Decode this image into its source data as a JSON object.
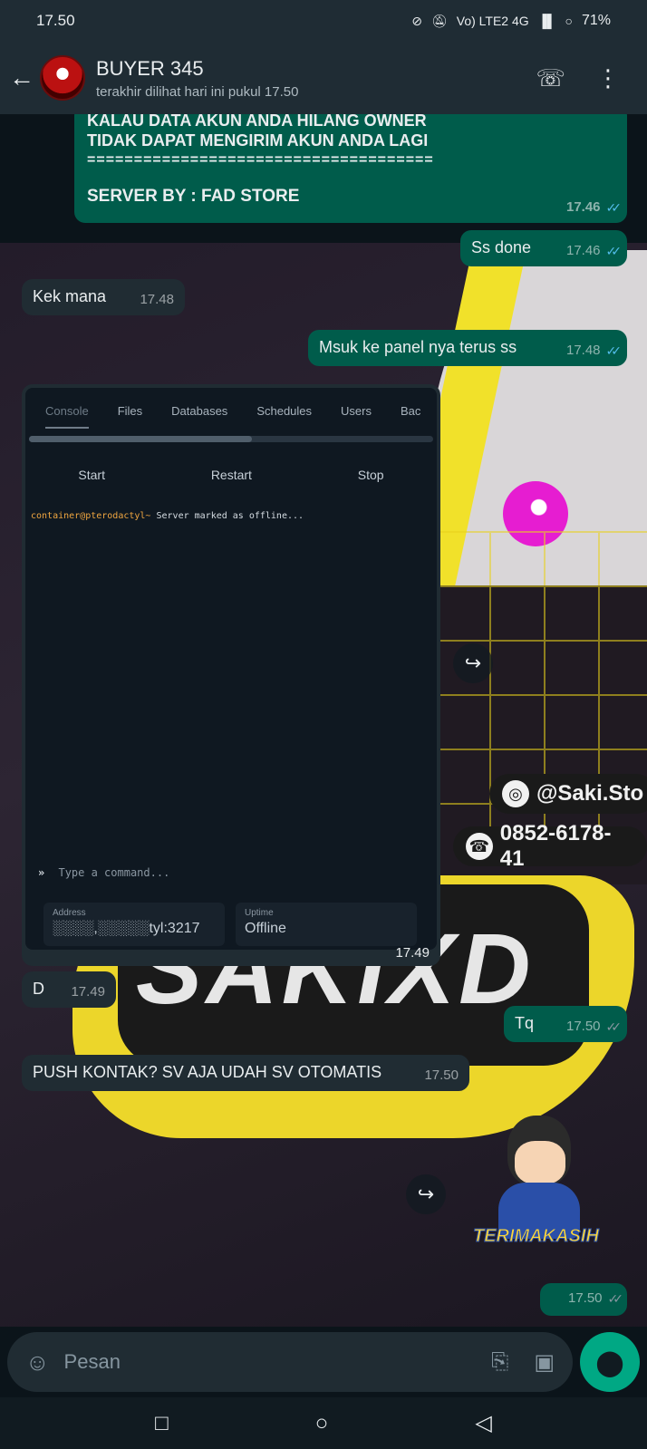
{
  "status_bar": {
    "time": "17.50",
    "network": "Vo) LTE2 4G",
    "battery": "71%"
  },
  "header": {
    "contact_name": "BUYER 345",
    "last_seen": "terakhir dilihat hari ini pukul 17.50"
  },
  "messages": [
    {
      "direction": "out",
      "lines": [
        "KALAU DATA AKUN ANDA HILANG OWNER",
        "TIDAK DAPAT MENGIRIM AKUN ANDA LAGI",
        "====================================="
      ],
      "footer": "SERVER BY : FAD STORE",
      "time": "17.46",
      "status": "read"
    },
    {
      "direction": "out",
      "text": "Ss done",
      "time": "17.46",
      "status": "read"
    },
    {
      "direction": "in",
      "text": "Kek mana",
      "time": "17.48"
    },
    {
      "direction": "out",
      "text": "Msuk ke panel nya terus ss",
      "time": "17.48",
      "status": "read"
    },
    {
      "direction": "in",
      "type": "image",
      "time": "17.49",
      "panel": {
        "tabs": [
          "Console",
          "Files",
          "Databases",
          "Schedules",
          "Users",
          "Bac"
        ],
        "controls": [
          "Start",
          "Restart",
          "Stop"
        ],
        "console_prompt": "container@pterodactyl~",
        "console_text": "Server marked as offline...",
        "command_placeholder": "Type a command...",
        "address_label": "Address",
        "address_value": "░░░░,░░░░░tyl:3217",
        "uptime_label": "Uptime",
        "uptime_value": "Offline"
      }
    },
    {
      "direction": "in",
      "text": "D",
      "time": "17.49"
    },
    {
      "direction": "out",
      "text": "Tq",
      "time": "17.50",
      "status": "delivered"
    },
    {
      "direction": "in",
      "text": "PUSH KONTAK? SV AJA UDAH SV OTOMATIS",
      "time": "17.50"
    },
    {
      "direction": "out",
      "type": "sticker",
      "sticker_text": "TERIMAKASIH",
      "time": "17.50",
      "status": "delivered"
    }
  ],
  "wallpaper": {
    "logo_text": "SAKIXD",
    "instagram": "@Saki.Sto",
    "whatsapp": "0852-6178-41"
  },
  "input": {
    "placeholder": "Pesan"
  },
  "colors": {
    "header_bg": "#1f2c34",
    "chat_bg": "#0b141a",
    "outgoing_bubble": "#005c4b",
    "incoming_bubble": "#202c33",
    "accent": "#00a884",
    "read_tick": "#53bdeb"
  },
  "icons": {
    "back": "arrow-left-icon",
    "add_call": "phone-plus-icon",
    "menu": "more-vertical-icon",
    "emoji": "emoji-icon",
    "attach": "paperclip-icon",
    "camera": "camera-icon",
    "mic": "mic-icon",
    "forward": "forward-icon"
  }
}
